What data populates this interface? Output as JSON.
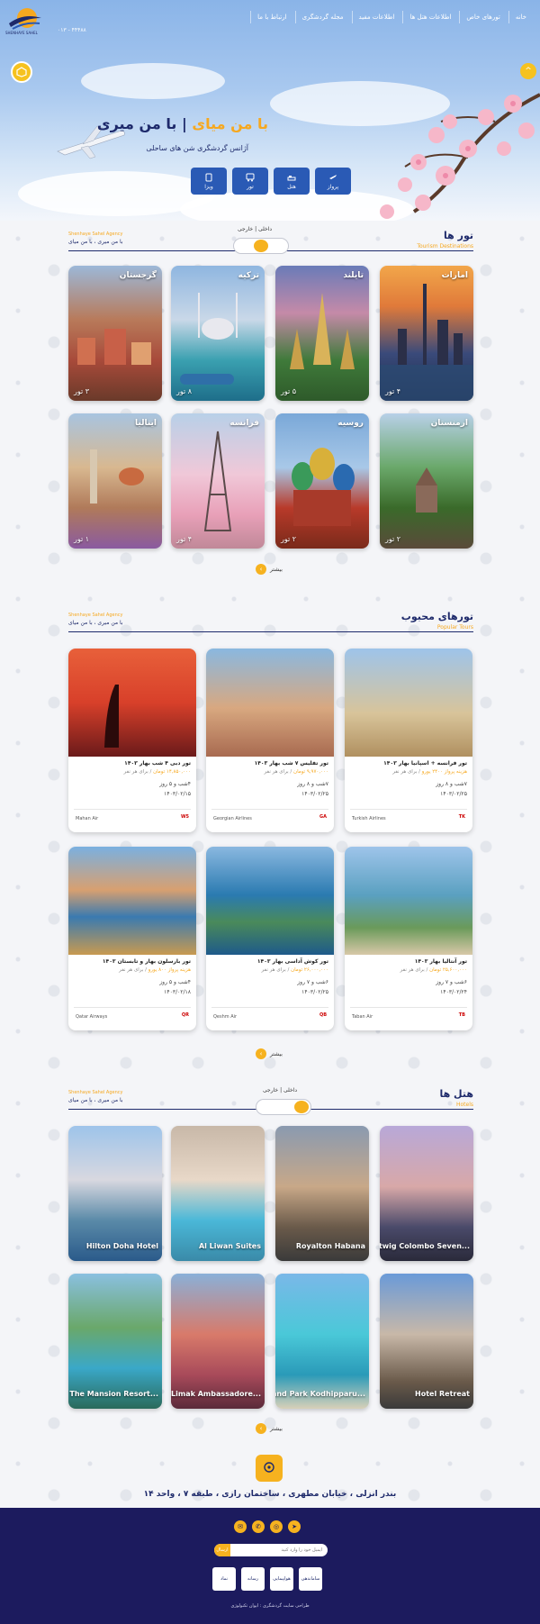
{
  "nav": {
    "items": [
      "خانه",
      "تورهای خاص",
      "اطلاعات هتل ها",
      "اطلاعات مفید",
      "مجله گردشگری",
      "ارتباط با ما"
    ],
    "phone": "۰۱۳ - ۴۴۴۸۸"
  },
  "hero": {
    "title_pre": "با من میری",
    "title_post": "با من میای",
    "subtitle": "آژانس گردشگری شن های ساحلی",
    "buttons": [
      "پرواز",
      "هتل",
      "تور",
      "ویزا"
    ]
  },
  "tours_section": {
    "title": "تور ها",
    "title_en": "Tourism Destinations",
    "agency": "Shenhaye Sahel Agency",
    "motto": "با من میری ، با من میای",
    "toggle": [
      "خارجی",
      "داخلی"
    ],
    "destinations": [
      {
        "name": "امارات",
        "count": "۴ تور"
      },
      {
        "name": "تایلند",
        "count": "۵ تور"
      },
      {
        "name": "ترکیه",
        "count": "۸ تور"
      },
      {
        "name": "گرجستان",
        "count": "۳ تور"
      },
      {
        "name": "ارمنستان",
        "count": "۲ تور"
      },
      {
        "name": "روسیه",
        "count": "۲ تور"
      },
      {
        "name": "فرانسه",
        "count": "۴ تور"
      },
      {
        "name": "ایتالیا",
        "count": "۱ تور"
      }
    ],
    "more": "بیشتر"
  },
  "popular_section": {
    "title": "تورهای محبوب",
    "title_en": "Popular Tours",
    "agency": "Shenhaye Sahel Agency",
    "motto": "با من میری ، با من میای",
    "tours": [
      {
        "name": "تور فرانسه + اسپانیا بهار ۱۴۰۳",
        "price": "هزینه پرواز ۲۴۰۰ یورو",
        "per": "/ برای هر نفر",
        "duration": "۷شب و ۸ روز",
        "date": "۱۴۰۳/۰۲/۲۵",
        "airline": "Turkish Airlines",
        "airline_logo": "TK"
      },
      {
        "name": "تور تفلیس ۷ شب بهار ۱۴۰۳",
        "price": "۹,۹۷۰,۰۰۰ تومان",
        "per": "/ برای هر نفر",
        "duration": "۷شب و ۸ روز",
        "date": "۱۴۰۳/۰۲/۲۵",
        "airline": "Georgian Airlines",
        "airline_logo": "GA"
      },
      {
        "name": "تور دبی ۴ شب بهار ۱۴۰۳",
        "price": "۱۴,۸۵۰,۰۰۰ تومان",
        "per": "/ برای هر نفر",
        "duration": "۴شب و ۵ روز",
        "date": "۱۴۰۳/۰۲/۱۵",
        "airline": "Mahan Air",
        "airline_logo": "W5"
      },
      {
        "name": "تور آنتالیا بهار ۱۴۰۳",
        "price": "۲۵,۶۰۰,۰۰۰ تومان",
        "per": "/ برای هر نفر",
        "duration": "۶شب و ۷ روز",
        "date": "۱۴۰۳/۰۲/۲۴",
        "airline": "Taban Air",
        "airline_logo": "TB"
      },
      {
        "name": "تور کوش آداسی بهار ۱۴۰۳",
        "price": "۲۶,۰۰۰,۰۰۰ تومان",
        "per": "/ برای هر نفر",
        "duration": "۶شب و ۷ روز",
        "date": "۱۴۰۳/۰۲/۲۵",
        "airline": "Qeshm Air",
        "airline_logo": "QB"
      },
      {
        "name": "تور بارسلون بهار و تابستان ۱۴۰۳",
        "price": "هزینه پرواز ۸۰۰ یورو",
        "per": "/ برای هر نفر",
        "duration": "۴شب و ۵ روز",
        "date": "۱۴۰۳/۰۲/۱۸",
        "airline": "Qatar Airways",
        "airline_logo": "QR"
      }
    ],
    "more": "بیشتر"
  },
  "hotels_section": {
    "title": "هتل ها",
    "title_en": "Hotels",
    "agency": "Shenhaye Sahel Agency",
    "motto": "با من میری ، با من میای",
    "toggle": [
      "خارجی",
      "داخلی"
    ],
    "hotels": [
      "etwig Colombo Seven...",
      "Royalton Habana",
      "Al Liwan Suites",
      "Hilton Doha Hotel",
      "Hotel Retreat",
      "rand Park Kodhipparu...",
      "Limak Ambassadore...",
      "The Mansion Resort..."
    ],
    "more": "بیشتر"
  },
  "footer": {
    "address": "بندر انزلی ، خیابان مطهری ، ساختمان رازی ، طبقه ۷ ، واحد ۱۴",
    "newsletter_placeholder": "ایمیل خود را وارد کنید",
    "newsletter_button": "ارسال",
    "badges": [
      "نماد",
      "رسانه",
      "هواپیمایی",
      "ساماندهی"
    ],
    "credit": "طراحی سایت گردشگری : ایوان تکنولوژی"
  },
  "colors": {
    "primary": "#1e2a6b",
    "accent": "#f6b21f",
    "footer": "#1c1b5e"
  }
}
